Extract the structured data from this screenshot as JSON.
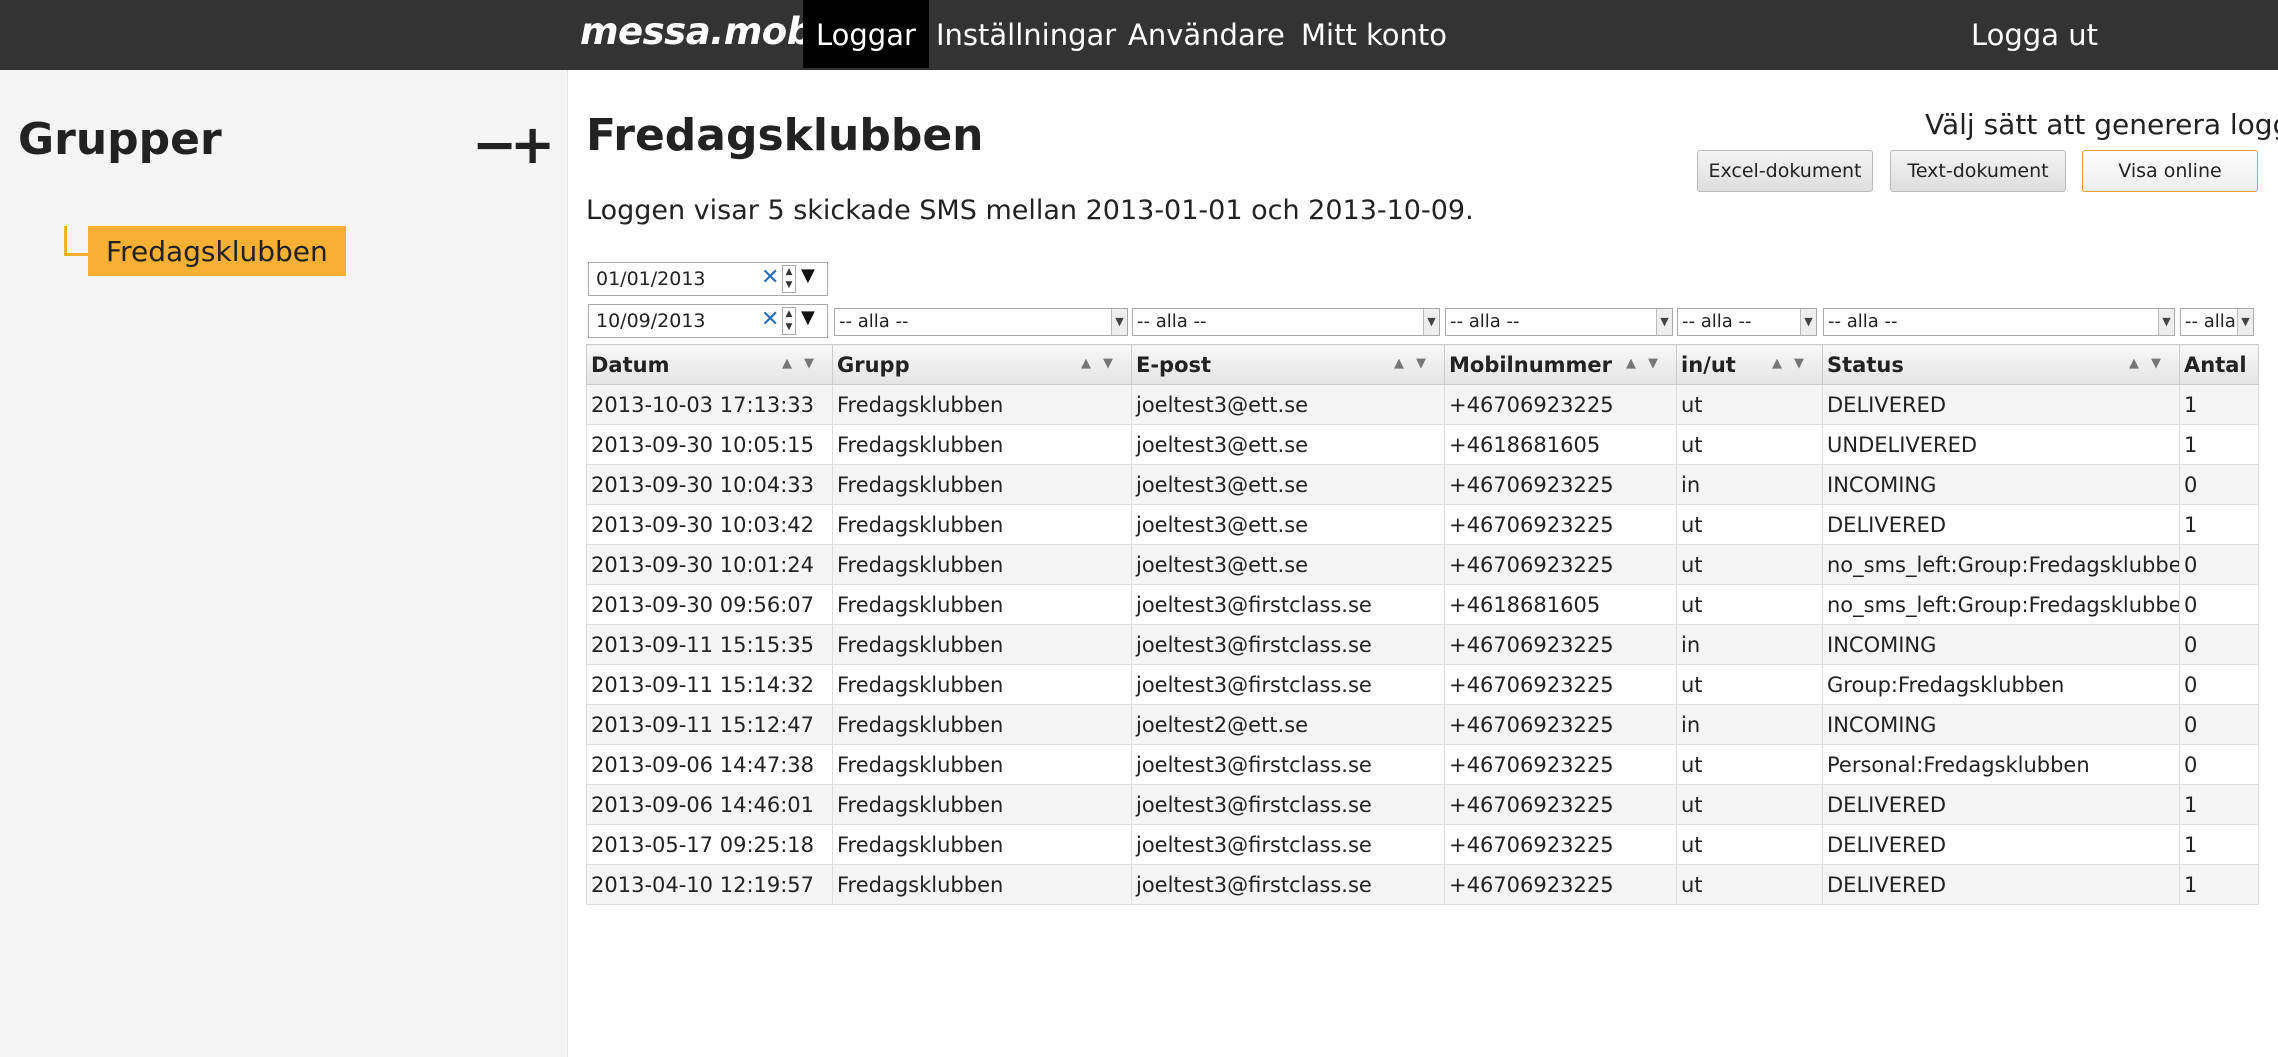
{
  "nav": {
    "logo": "messa.mobi",
    "items": [
      "Loggar",
      "Inställningar",
      "Användare",
      "Mitt konto"
    ],
    "logout": "Logga ut"
  },
  "sidebar": {
    "title": "Grupper",
    "remove_label": "−",
    "add_label": "+",
    "groups": [
      "Fredagsklubben"
    ]
  },
  "main": {
    "title": "Fredagsklubben",
    "subtitle": "Loggen visar 5 skickade SMS mellan 2013-01-01 och 2013-10-09.",
    "generate_label": "Välj sätt att generera logg",
    "buttons": {
      "excel": "Excel-dokument",
      "text": "Text-dokument",
      "online": "Visa online"
    },
    "date_from": "01/01/2013",
    "date_to": "10/09/2013",
    "filter_placeholder": "-- alla --",
    "filter_short": "-- alla",
    "columns": [
      "Datum",
      "Grupp",
      "E-post",
      "Mobilnummer",
      "in/ut",
      "Status",
      "Antal"
    ],
    "rows": [
      [
        "2013-10-03 17:13:33",
        "Fredagsklubben",
        "joeltest3@ett.se",
        "+46706923225",
        "ut",
        "DELIVERED",
        "1"
      ],
      [
        "2013-09-30 10:05:15",
        "Fredagsklubben",
        "joeltest3@ett.se",
        "+4618681605",
        "ut",
        "UNDELIVERED",
        "1"
      ],
      [
        "2013-09-30 10:04:33",
        "Fredagsklubben",
        "joeltest3@ett.se",
        "+46706923225",
        "in",
        "INCOMING",
        "0"
      ],
      [
        "2013-09-30 10:03:42",
        "Fredagsklubben",
        "joeltest3@ett.se",
        "+46706923225",
        "ut",
        "DELIVERED",
        "1"
      ],
      [
        "2013-09-30 10:01:24",
        "Fredagsklubben",
        "joeltest3@ett.se",
        "+46706923225",
        "ut",
        "no_sms_left:Group:Fredagsklubben",
        "0"
      ],
      [
        "2013-09-30 09:56:07",
        "Fredagsklubben",
        "joeltest3@firstclass.se",
        "+4618681605",
        "ut",
        "no_sms_left:Group:Fredagsklubben",
        "0"
      ],
      [
        "2013-09-11 15:15:35",
        "Fredagsklubben",
        "joeltest3@firstclass.se",
        "+46706923225",
        "in",
        "INCOMING",
        "0"
      ],
      [
        "2013-09-11 15:14:32",
        "Fredagsklubben",
        "joeltest3@firstclass.se",
        "+46706923225",
        "ut",
        "Group:Fredagsklubben",
        "0"
      ],
      [
        "2013-09-11 15:12:47",
        "Fredagsklubben",
        "joeltest2@ett.se",
        "+46706923225",
        "in",
        "INCOMING",
        "0"
      ],
      [
        "2013-09-06 14:47:38",
        "Fredagsklubben",
        "joeltest3@firstclass.se",
        "+46706923225",
        "ut",
        "Personal:Fredagsklubben",
        "0"
      ],
      [
        "2013-09-06 14:46:01",
        "Fredagsklubben",
        "joeltest3@firstclass.se",
        "+46706923225",
        "ut",
        "DELIVERED",
        "1"
      ],
      [
        "2013-05-17 09:25:18",
        "Fredagsklubben",
        "joeltest3@firstclass.se",
        "+46706923225",
        "ut",
        "DELIVERED",
        "1"
      ],
      [
        "2013-04-10 12:19:57",
        "Fredagsklubben",
        "joeltest3@firstclass.se",
        "+46706923225",
        "ut",
        "DELIVERED",
        "1"
      ]
    ]
  }
}
